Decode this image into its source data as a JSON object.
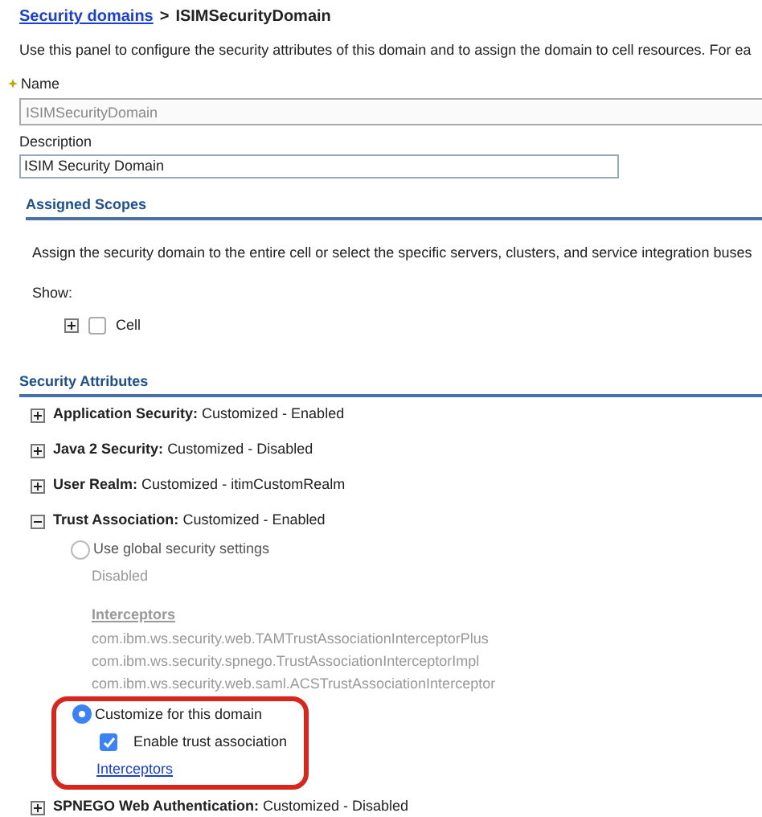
{
  "breadcrumb": {
    "link": "Security domains",
    "separator": ">",
    "current": "ISIMSecurityDomain"
  },
  "intro": "Use this panel to configure the security attributes of this domain and to assign the domain to cell resources. For ea",
  "name_field": {
    "label": "Name",
    "required": true,
    "value": "ISIMSecurityDomain",
    "disabled": true
  },
  "description_field": {
    "label": "Description",
    "value": "ISIM Security Domain",
    "disabled": false
  },
  "assigned_scopes": {
    "title": "Assigned Scopes",
    "text": "Assign the security domain to the entire cell or select the specific servers, clusters, and service integration buses",
    "show_label": "Show:",
    "tree": [
      {
        "label": "Cell",
        "expanded": false,
        "checked": false
      }
    ]
  },
  "security_attributes": {
    "title": "Security Attributes",
    "items": [
      {
        "name": "Application Security:",
        "value": "Customized - Enabled",
        "expanded": false
      },
      {
        "name": "Java 2 Security:",
        "value": "Customized - Disabled",
        "expanded": false
      },
      {
        "name": "User Realm:",
        "value": "Customized - itimCustomRealm",
        "expanded": false
      },
      {
        "name": "Trust Association:",
        "value": "Customized - Enabled",
        "expanded": true,
        "options": [
          {
            "label": "Use global security settings",
            "selected": false,
            "status": "Disabled",
            "interceptors_label": "Interceptors",
            "interceptors": [
              "com.ibm.ws.security.web.TAMTrustAssociationInterceptorPlus",
              "com.ibm.ws.security.spnego.TrustAssociationInterceptorImpl",
              "com.ibm.ws.security.web.saml.ACSTrustAssociationInterceptor"
            ]
          },
          {
            "label": "Customize for this domain",
            "selected": true,
            "highlighted": true,
            "checkbox": {
              "label": "Enable trust association",
              "checked": true
            },
            "link": "Interceptors"
          }
        ]
      },
      {
        "name": "SPNEGO Web Authentication:",
        "value": "Customized - Disabled",
        "expanded": false
      }
    ]
  }
}
